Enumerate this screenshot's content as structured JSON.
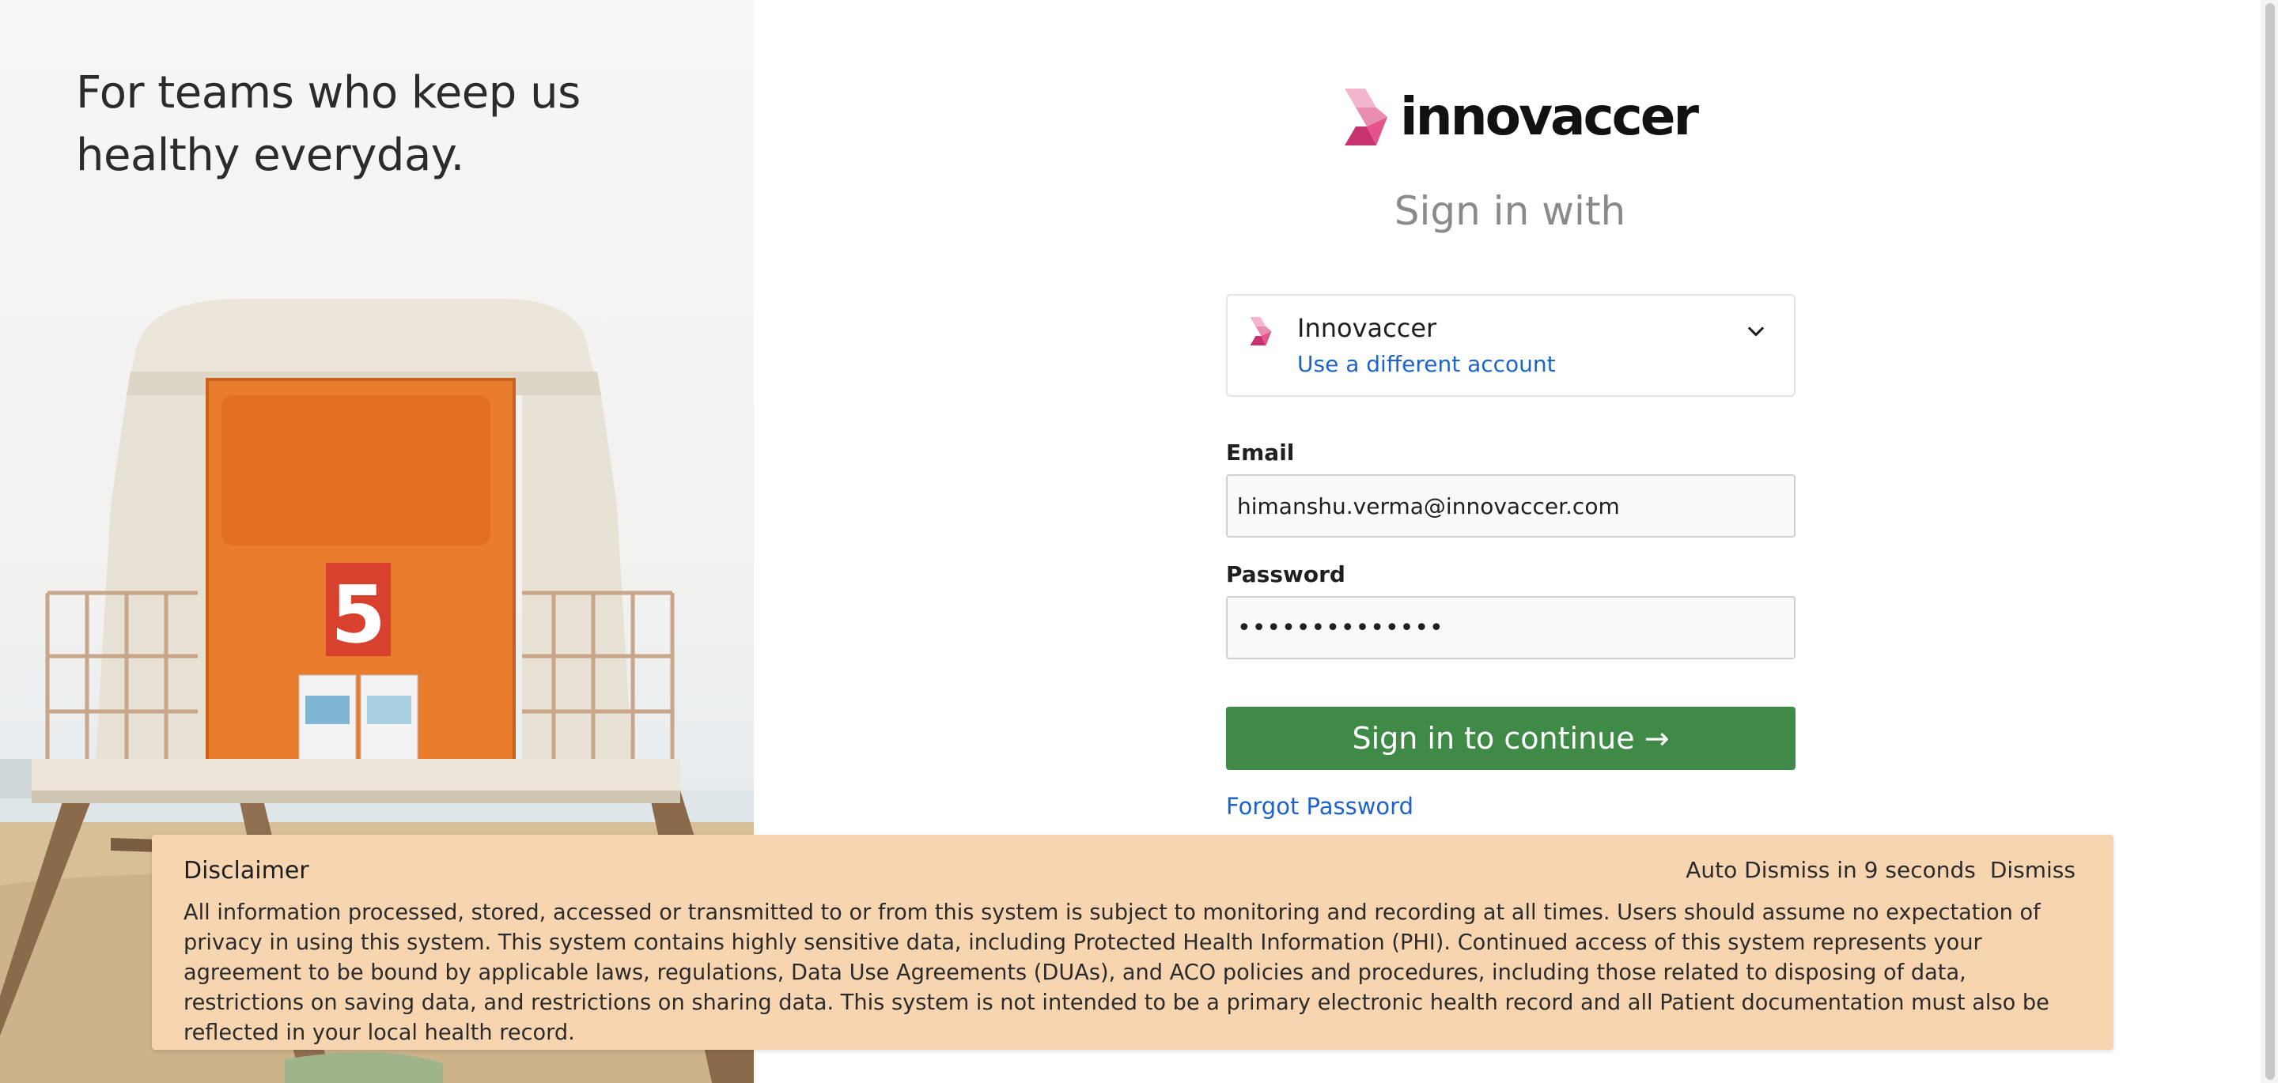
{
  "hero": {
    "tagline": "For teams who keep us healthy everyday.",
    "tower_number": "5"
  },
  "brand": {
    "name": "innovaccer",
    "logo_icon": "innovaccer-logo-icon",
    "colors": {
      "pink_light": "#f4b6cf",
      "pink": "#e3548e",
      "pink_dark": "#c8336f"
    }
  },
  "signin": {
    "heading": "Sign in with",
    "account": {
      "name": "Innovaccer",
      "switch_link": "Use a different account"
    },
    "email": {
      "label": "Email",
      "value": "himanshu.verma@innovaccer.com"
    },
    "password": {
      "label": "Password",
      "value": "••••••••••••••"
    },
    "submit_label": "Sign in to continue →",
    "forgot_link": "Forgot Password",
    "button_color": "#3f8a47",
    "link_color": "#1d63c9"
  },
  "disclaimer": {
    "title": "Disclaimer",
    "auto_dismiss": "Auto Dismiss in 9 seconds",
    "dismiss_label": "Dismiss",
    "body": "All information processed, stored, accessed or transmitted to or from this system is subject to monitoring and recording at all times. Users should assume no expectation of privacy in using this system. This system contains highly sensitive data, including Protected Health Information (PHI). Continued access of this system represents your agreement to be bound by applicable laws, regulations, Data Use Agreements (DUAs), and ACO policies and procedures, including those related to disposing of data, restrictions on saving data, and restrictions on sharing data. This system is not intended to be a primary electronic health record and all Patient documentation must also be reflected in your local health record.",
    "background": "#f7d5b0"
  }
}
